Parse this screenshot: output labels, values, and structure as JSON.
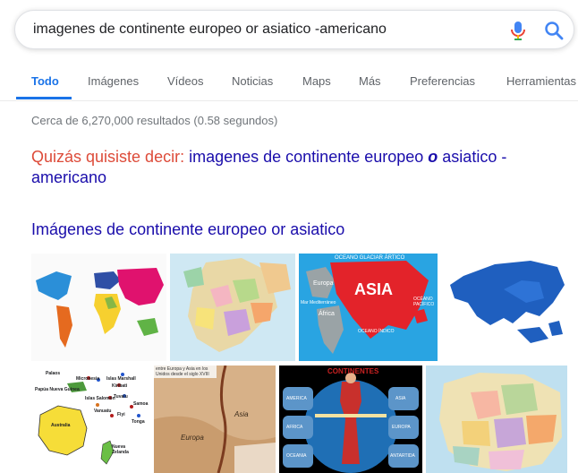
{
  "search": {
    "query": "imagenes de continente europeo or asiatico -americano"
  },
  "tabs": [
    "Todo",
    "Imágenes",
    "Vídeos",
    "Noticias",
    "Maps",
    "Más",
    "Preferencias",
    "Herramientas"
  ],
  "stats": "Cerca de 6,270,000 resultados (0.58 segundos)",
  "did_you_mean": {
    "prefix": "Quizás quisiste decir:",
    "before": "imagenes de continente europeo ",
    "emphasis": "o",
    "after": " asiatico -americano"
  },
  "images_heading": "Imágenes de continente europeo or asiatico",
  "thumbnails": {
    "asia_map": {
      "top_label": "OCEANO GLACIAR ÁRTICO",
      "title": "ASIA",
      "europa": "Europa",
      "africa": "África",
      "mar_med": "Mar Mediterráneo",
      "indico": "OCEANO ÍNDICO",
      "pacifico": "OCÉANO PACÍFICO"
    },
    "oceania_map": {
      "labels": [
        "Palaos",
        "Micronesia",
        "Islas Marshall",
        "Kiribati",
        "Papúa Nueva Guinea",
        "Tuvalu",
        "Islas Salomón",
        "Samoa",
        "Vanuatu",
        "Fiyi",
        "Tonga",
        "Australia",
        "Nueva Zelanda"
      ]
    },
    "history_map": {
      "caption": "entre Europa y Asia en los\nUnidos desde el siglo XVIII",
      "asia": "Asia",
      "europa": "Europa"
    },
    "continents_poster": {
      "title": "CONTINENTES",
      "left_top": "AMERICA",
      "left_mid": "AFRICA",
      "left_bot": "OCEANIA",
      "right_top": "ASIA",
      "right_mid": "EUROPA",
      "right_bot": "ANTARTIDA"
    }
  },
  "colors": {
    "link": "#1a0dab",
    "correction": "#dd4b39",
    "tab_active": "#1a73e8"
  }
}
